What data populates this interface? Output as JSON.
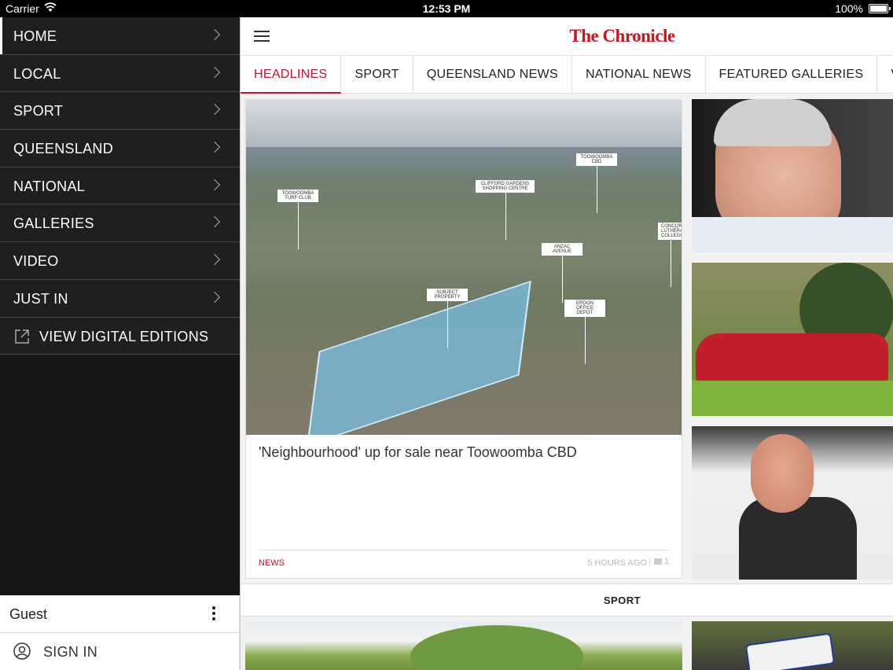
{
  "status_bar": {
    "carrier": "Carrier",
    "time": "12:53 PM",
    "battery": "100%"
  },
  "sidebar": {
    "items": [
      {
        "label": "HOME"
      },
      {
        "label": "LOCAL"
      },
      {
        "label": "SPORT"
      },
      {
        "label": "QUEENSLAND"
      },
      {
        "label": "NATIONAL"
      },
      {
        "label": "GALLERIES"
      },
      {
        "label": "VIDEO"
      },
      {
        "label": "JUST IN"
      }
    ],
    "digital_editions": "VIEW DIGITAL EDITIONS",
    "user": {
      "name": "Guest",
      "sign_in": "SIGN IN"
    }
  },
  "header": {
    "logo": "The Chronicle"
  },
  "tabs": [
    {
      "label": "HEADLINES",
      "active": true
    },
    {
      "label": "SPORT"
    },
    {
      "label": "QUEENSLAND NEWS"
    },
    {
      "label": "NATIONAL NEWS"
    },
    {
      "label": "FEATURED GALLERIES"
    },
    {
      "label": "VIDEO"
    }
  ],
  "main_story": {
    "headline": "'Neighbourhood' up for sale near Toowoomba CBD",
    "category": "NEWS",
    "time_ago": "5 HOURS AGO",
    "comments": "1",
    "map_tags": {
      "turf_club": "TOOWOOMBA TURF CLUB",
      "gardens": "CLIFFORD GARDENS SHOPPING CENTRE",
      "cbd": "TOOWOOMBA CBD",
      "concordia": "CONCORDIA LUTHERAN COLLEGE",
      "anzac": "ANZAC AVENUE",
      "subject": "SUBJECT PROPERTY",
      "ergon": "ERGON OFFICE DEPOT"
    }
  },
  "section": {
    "label": "SPORT"
  }
}
